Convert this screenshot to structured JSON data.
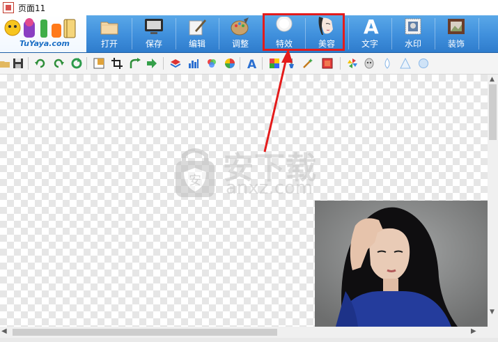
{
  "window": {
    "title": "页面11"
  },
  "logo": {
    "text": "TuYaya.com"
  },
  "toolbar": {
    "buttons": [
      {
        "label": "打开",
        "icon": "open-folder-icon"
      },
      {
        "label": "保存",
        "icon": "save-monitor-icon"
      },
      {
        "label": "编辑",
        "icon": "edit-pen-icon"
      },
      {
        "label": "调整",
        "icon": "adjust-palette-icon"
      },
      {
        "label": "特效",
        "icon": "effects-plate-icon"
      },
      {
        "label": "美容",
        "icon": "beauty-face-icon"
      },
      {
        "label": "文字",
        "icon": "text-letter-icon"
      },
      {
        "label": "水印",
        "icon": "watermark-stamp-icon"
      },
      {
        "label": "装饰",
        "icon": "decoration-frame-icon"
      }
    ],
    "highlighted": [
      "特效",
      "美容"
    ]
  },
  "sub_toolbar": {
    "icons": [
      "open-small-icon",
      "save-small-icon",
      "undo-icon",
      "redo-icon",
      "refresh-icon",
      "resize-icon",
      "crop-icon",
      "rotate-icon",
      "next-icon",
      "layers-icon",
      "histogram-icon",
      "color-balance-icon",
      "color-wheel-icon",
      "text-style-icon",
      "gradient-icon",
      "brush-icon",
      "magic-wand-icon",
      "fill-icon",
      "pinwheel-icon",
      "face-mask-icon",
      "drop-icon",
      "triangle-icon",
      "circle-icon"
    ]
  },
  "watermark": {
    "cn": "安下载",
    "en": "anxz.com",
    "badge": "安"
  },
  "colors": {
    "toolbar": "#3f8fdc",
    "highlight": "#e41b1b",
    "arrow": "#e41b1b"
  }
}
